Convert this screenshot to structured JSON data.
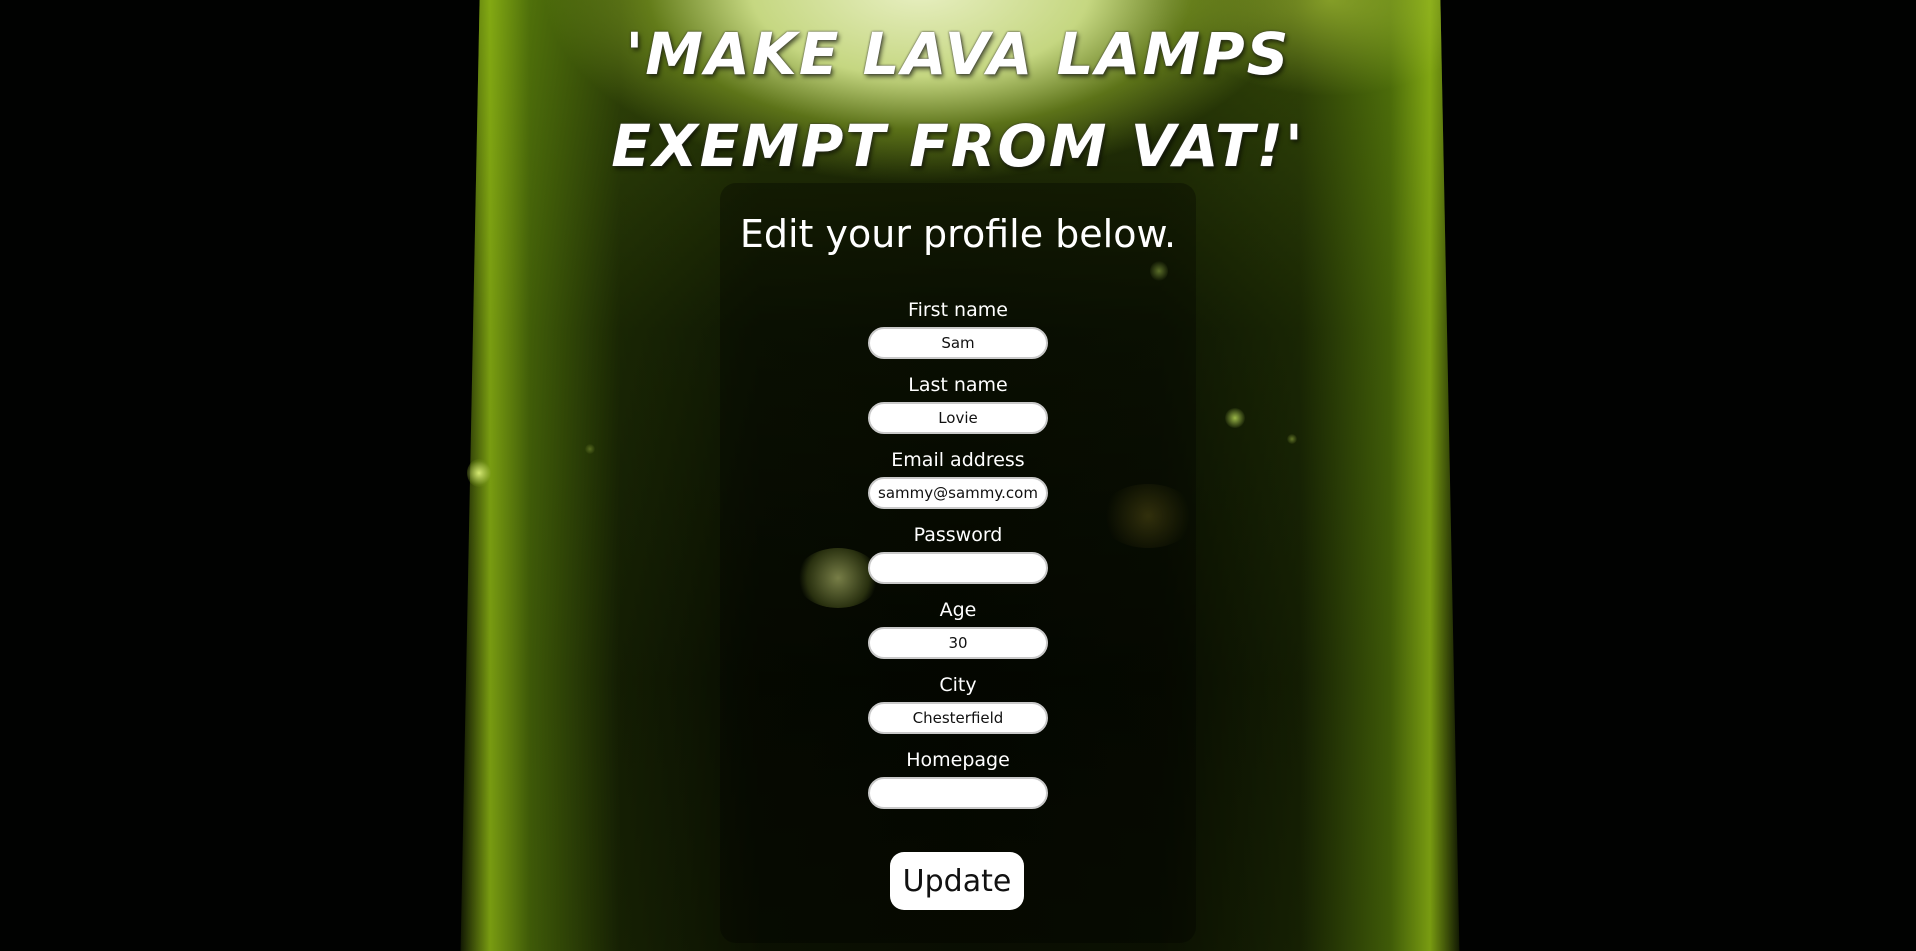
{
  "header": {
    "title_line1": "'Make lava lamps",
    "title_line2": "exempt from VAT!'"
  },
  "profile_form": {
    "heading": "Edit your profile below.",
    "fields": [
      {
        "label": "First name",
        "value": "Sam"
      },
      {
        "label": "Last name",
        "value": "Lovie"
      },
      {
        "label": "Email address",
        "value": "sammy@sammy.com"
      },
      {
        "label": "Password",
        "value": ""
      },
      {
        "label": "Age",
        "value": "30"
      },
      {
        "label": "City",
        "value": "Chesterfield"
      },
      {
        "label": "Homepage",
        "value": ""
      }
    ],
    "submit_label": "Update"
  }
}
